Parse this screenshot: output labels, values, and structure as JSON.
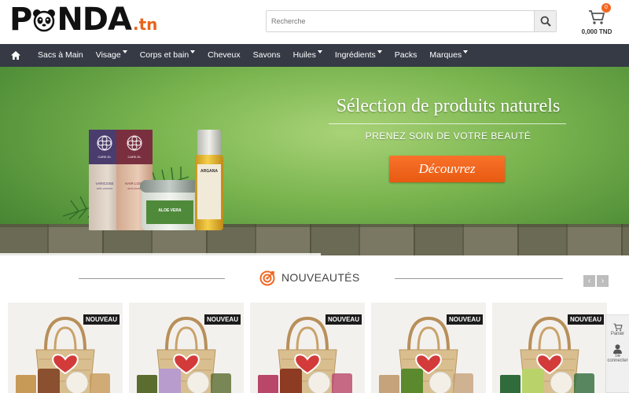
{
  "header": {
    "logo_text": "PANDA",
    "logo_tld": ".tn",
    "search_placeholder": "Recherche",
    "cart_count": "0",
    "cart_total": "0,000 TND"
  },
  "nav": {
    "items": [
      {
        "label": "Sacs à Main",
        "dropdown": false
      },
      {
        "label": "Visage",
        "dropdown": true
      },
      {
        "label": "Corps et bain",
        "dropdown": true
      },
      {
        "label": "Cheveux",
        "dropdown": false
      },
      {
        "label": "Savons",
        "dropdown": false
      },
      {
        "label": "Huiles",
        "dropdown": true
      },
      {
        "label": "Ingrédients",
        "dropdown": true
      },
      {
        "label": "Packs",
        "dropdown": false
      },
      {
        "label": "Marques",
        "dropdown": true
      }
    ]
  },
  "banner": {
    "title": "Sélection de produits naturels",
    "subtitle": "PRENEZ SOIN DE VOTRE BEAUTÉ",
    "cta": "Découvrez",
    "product_labels": {
      "box1_brand": "CARE.EL",
      "box1_name": "VARICOSE",
      "box1_desc": "anti-varices",
      "box2_brand": "CARE.EL",
      "box2_name": "HAIR LOSS",
      "box2_desc": "anti-chute",
      "jar": "ALOE VERA",
      "bottle": "ARGANA"
    },
    "progress": 0.51
  },
  "section": {
    "title": "NOUVEAUTÉS",
    "prev": "‹",
    "next": "›"
  },
  "products": [
    {
      "badge": "NOUVEAU"
    },
    {
      "badge": "NOUVEAU"
    },
    {
      "badge": "NOUVEAU"
    },
    {
      "badge": "NOUVEAU"
    },
    {
      "badge": "NOUVEAU"
    }
  ],
  "side_widget": {
    "cart_label": "Panier",
    "account_label": "Se connecter"
  },
  "colors": {
    "nav_bg": "#353a45",
    "accent": "#f26722",
    "banner_green": "#79b44f"
  }
}
